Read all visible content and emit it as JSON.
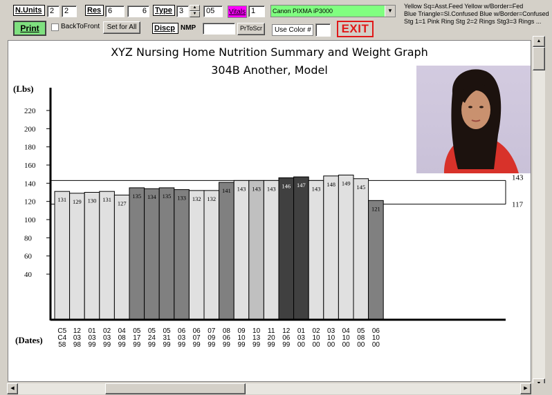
{
  "toolbar": {
    "n_units_label": "N.Units",
    "n_units_a": "2",
    "n_units_b": "2",
    "res_label": "Res",
    "res_a": "6",
    "res_b": "6",
    "type_label": "Type",
    "type_value": "3",
    "type_extra": "05",
    "vitals_label": "Vitals",
    "vitals_value": "1",
    "printer": "Canon PIXMA iP3000",
    "print_label": "Print",
    "back_to_front_label": "BackToFront",
    "set_for_all_label": "Set for All",
    "discp_label": "Discp",
    "nmp_label": "NMP",
    "prtoscr_label": "PrToScr",
    "use_color_label": "Use Color #",
    "exit_label": "EXIT"
  },
  "legend_notes": [
    "Yellow Sq=Asst.Feed  Yellow w/Border=Fed",
    "Blue Triangle=Sl.Confused  Blue w/Border=Confused",
    "Stg 1=1 Pink Ring  Stg 2=2 Rings  Stg3=3 Rings ..."
  ],
  "colors": {
    "green_button": "#7fe07f",
    "printer_bg": "#80ff80",
    "vitals_bg": "#ff00ff",
    "exit_red": "#e01818",
    "bar_light": "#e0e0e0",
    "bar_lightmid": "#c0c0c0",
    "bar_mid": "#808080",
    "bar_dark": "#404040"
  },
  "chart_data": {
    "type": "bar",
    "title": "XYZ Nursing Home Nutrition Summary and Weight Graph",
    "subtitle": "304B Another, Model",
    "ylabel": "(Lbs)",
    "xlabel": "(Dates)",
    "ylim": [
      0,
      240
    ],
    "yticks": [
      40,
      60,
      80,
      100,
      120,
      140,
      160,
      180,
      200,
      220
    ],
    "reference_band": {
      "upper": 143,
      "lower": 117
    },
    "categories": [
      [
        "C5",
        "C4",
        "58"
      ],
      [
        "12",
        "03",
        "98"
      ],
      [
        "01",
        "03",
        "99"
      ],
      [
        "02",
        "03",
        "99"
      ],
      [
        "04",
        "08",
        "99"
      ],
      [
        "05",
        "17",
        "99"
      ],
      [
        "05",
        "24",
        "99"
      ],
      [
        "05",
        "31",
        "99"
      ],
      [
        "06",
        "03",
        "99"
      ],
      [
        "06",
        "07",
        "99"
      ],
      [
        "07",
        "09",
        "99"
      ],
      [
        "08",
        "06",
        "99"
      ],
      [
        "09",
        "10",
        "99"
      ],
      [
        "10",
        "13",
        "99"
      ],
      [
        "11",
        "20",
        "99"
      ],
      [
        "12",
        "06",
        "99"
      ],
      [
        "01",
        "03",
        "00"
      ],
      [
        "02",
        "10",
        "00"
      ],
      [
        "03",
        "10",
        "00"
      ],
      [
        "04",
        "10",
        "00"
      ],
      [
        "05",
        "08",
        "00"
      ],
      [
        "06",
        "10",
        "00"
      ]
    ],
    "values": [
      131,
      129,
      130,
      131,
      127,
      135,
      134,
      135,
      133,
      132,
      132,
      141,
      143,
      143,
      143,
      146,
      147,
      143,
      148,
      149,
      145,
      121
    ],
    "shades": [
      "light",
      "light",
      "light",
      "light",
      "light",
      "mid",
      "mid",
      "mid",
      "mid",
      "light",
      "light",
      "mid",
      "light",
      "lightmid",
      "light",
      "dark",
      "dark",
      "light",
      "light",
      "light",
      "light",
      "mid"
    ]
  }
}
